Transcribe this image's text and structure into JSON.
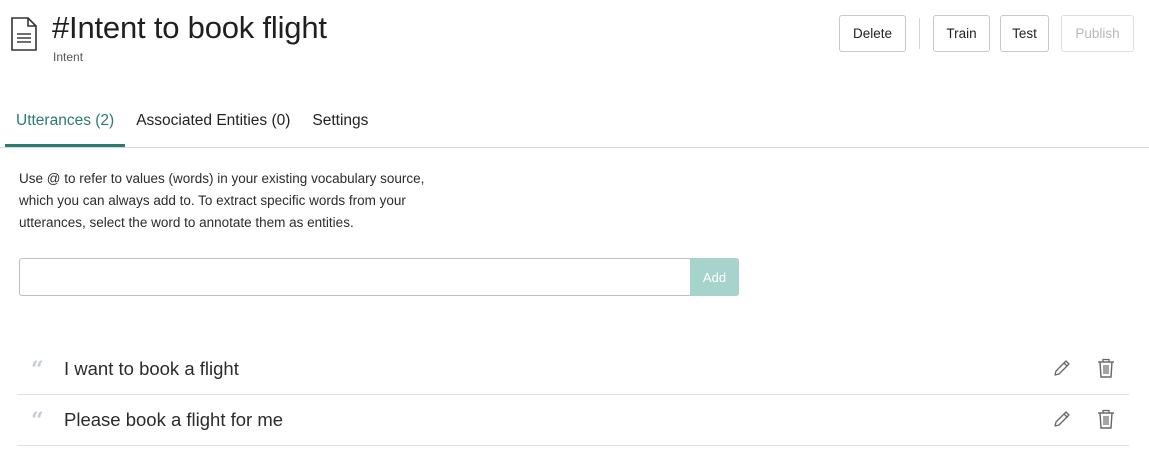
{
  "header": {
    "title": "#Intent to book flight",
    "subtitle": "Intent",
    "icon": "document-icon"
  },
  "toolbar": {
    "delete_label": "Delete",
    "train_label": "Train",
    "test_label": "Test",
    "publish_label": "Publish",
    "publish_disabled": true
  },
  "tabs": [
    {
      "label": "Utterances (2)",
      "active": true
    },
    {
      "label": "Associated Entities (0)",
      "active": false
    },
    {
      "label": "Settings",
      "active": false
    }
  ],
  "help": {
    "line1": "Use @ to refer to values (words) in your existing vocabulary source,",
    "line2": "which you can always add to. To extract specific words from your",
    "line3": "utterances, select the word to annotate them as entities."
  },
  "utterance_input": {
    "value": "",
    "placeholder": "",
    "add_label": "Add"
  },
  "utterances": [
    {
      "text": "I want to book a flight",
      "icons": [
        "quote-icon",
        "pencil-icon",
        "trash-icon"
      ]
    },
    {
      "text": "Please book a flight for me",
      "icons": [
        "quote-icon",
        "pencil-icon",
        "trash-icon"
      ]
    }
  ],
  "colors": {
    "accent": "#2a7c70",
    "add_button": "#a6d3cc",
    "quote_mark": "#c5ccd6"
  }
}
